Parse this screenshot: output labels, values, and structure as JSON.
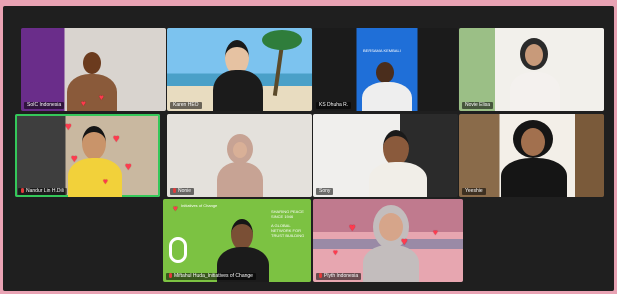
{
  "meeting": {
    "participants": [
      {
        "name": "SoIC Indonesia",
        "muted": false
      },
      {
        "name": "Karen HEO",
        "muted": false
      },
      {
        "name": "KS Dhuha R.",
        "muted": false
      },
      {
        "name": "Novie Elisa",
        "muted": false
      },
      {
        "name": "Nandur Lin H.Dili",
        "muted": true
      },
      {
        "name": "Nonie",
        "muted": true
      },
      {
        "name": "Sony",
        "muted": false
      },
      {
        "name": "Yeeshie",
        "muted": false
      },
      {
        "name": "Miftahul Huda_Initiatives of Change",
        "muted": true
      },
      {
        "name": "Plyth Indonesia",
        "muted": true
      }
    ],
    "active_speaker": "Nandur Lin H.Dili",
    "background_text": {
      "banner_small": "BERSAMA KEMBALI",
      "iofc_title": "Initiatives of Change",
      "iofc_headline": "SHARING PEACE SINCE 1946",
      "iofc_sub": "A GLOBAL NETWORK FOR TRUST BUILDING"
    }
  },
  "colors": {
    "background": "#e9a3b4",
    "frame": "#1f1f1f",
    "active_border": "#35c85a",
    "heart": "#ff3b4e",
    "iofc_green": "#7cc242"
  }
}
